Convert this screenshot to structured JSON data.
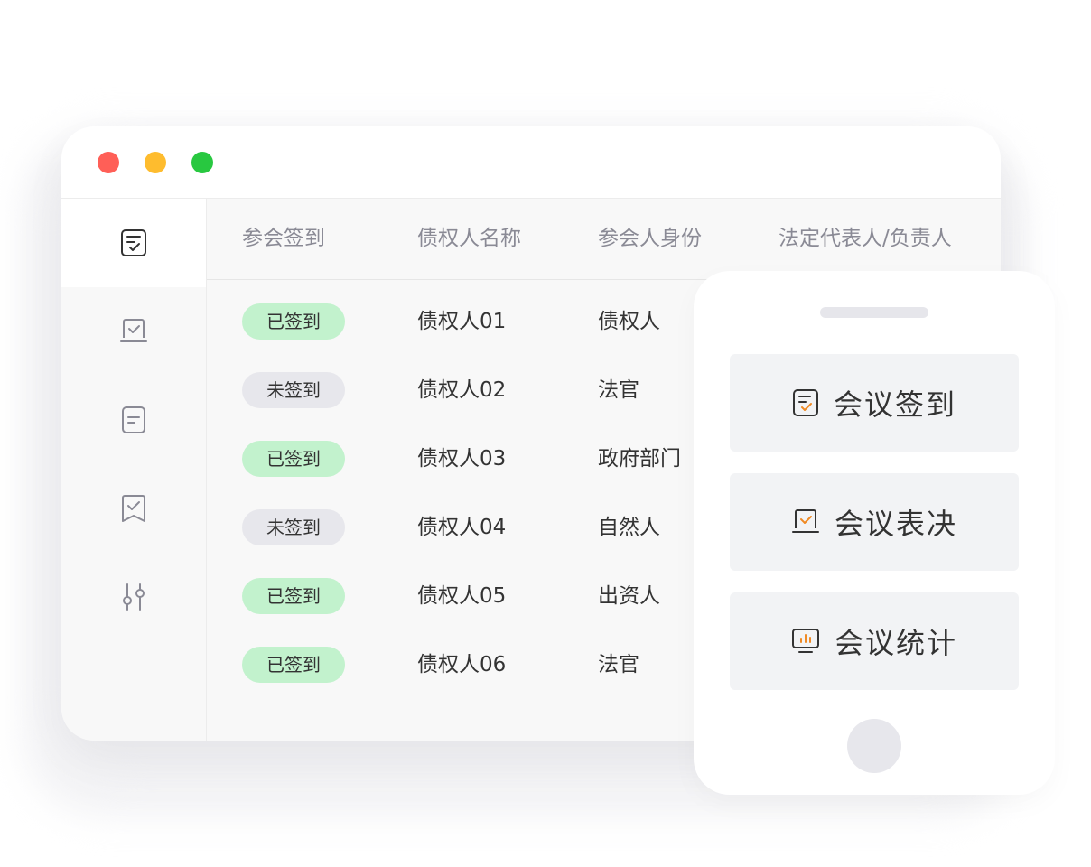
{
  "window": {
    "traffic_lights": [
      {
        "name": "close-button",
        "color": "#ff5f57"
      },
      {
        "name": "minimize-button",
        "color": "#febc2e"
      },
      {
        "name": "maximize-button",
        "color": "#28c840"
      }
    ]
  },
  "sidebar": {
    "items": [
      {
        "icon": "checklist-icon",
        "active": true
      },
      {
        "icon": "laptop-check-icon",
        "active": false
      },
      {
        "icon": "document-icon",
        "active": false
      },
      {
        "icon": "bookmark-check-icon",
        "active": false
      },
      {
        "icon": "sliders-icon",
        "active": false
      }
    ]
  },
  "table": {
    "columns": [
      "参会签到",
      "债权人名称",
      "参会人身份",
      "法定代表人/负责人"
    ],
    "rows": [
      {
        "status": "已签到",
        "signed": true,
        "name": "债权人01",
        "identity": "债权人"
      },
      {
        "status": "未签到",
        "signed": false,
        "name": "债权人02",
        "identity": "法官"
      },
      {
        "status": "已签到",
        "signed": true,
        "name": "债权人03",
        "identity": "政府部门"
      },
      {
        "status": "未签到",
        "signed": false,
        "name": "债权人04",
        "identity": "自然人"
      },
      {
        "status": "已签到",
        "signed": true,
        "name": "债权人05",
        "identity": "出资人"
      },
      {
        "status": "已签到",
        "signed": true,
        "name": "债权人06",
        "identity": "法官"
      }
    ]
  },
  "phone": {
    "buttons": [
      {
        "label": "会议签到",
        "icon": "meeting-checkin-icon"
      },
      {
        "label": "会议表决",
        "icon": "meeting-vote-icon"
      },
      {
        "label": "会议统计",
        "icon": "meeting-stats-icon"
      }
    ]
  },
  "colors": {
    "accent": "#f08a24",
    "signed_badge": "#c2f2cd",
    "unsigned_badge": "#e7e7ec"
  }
}
